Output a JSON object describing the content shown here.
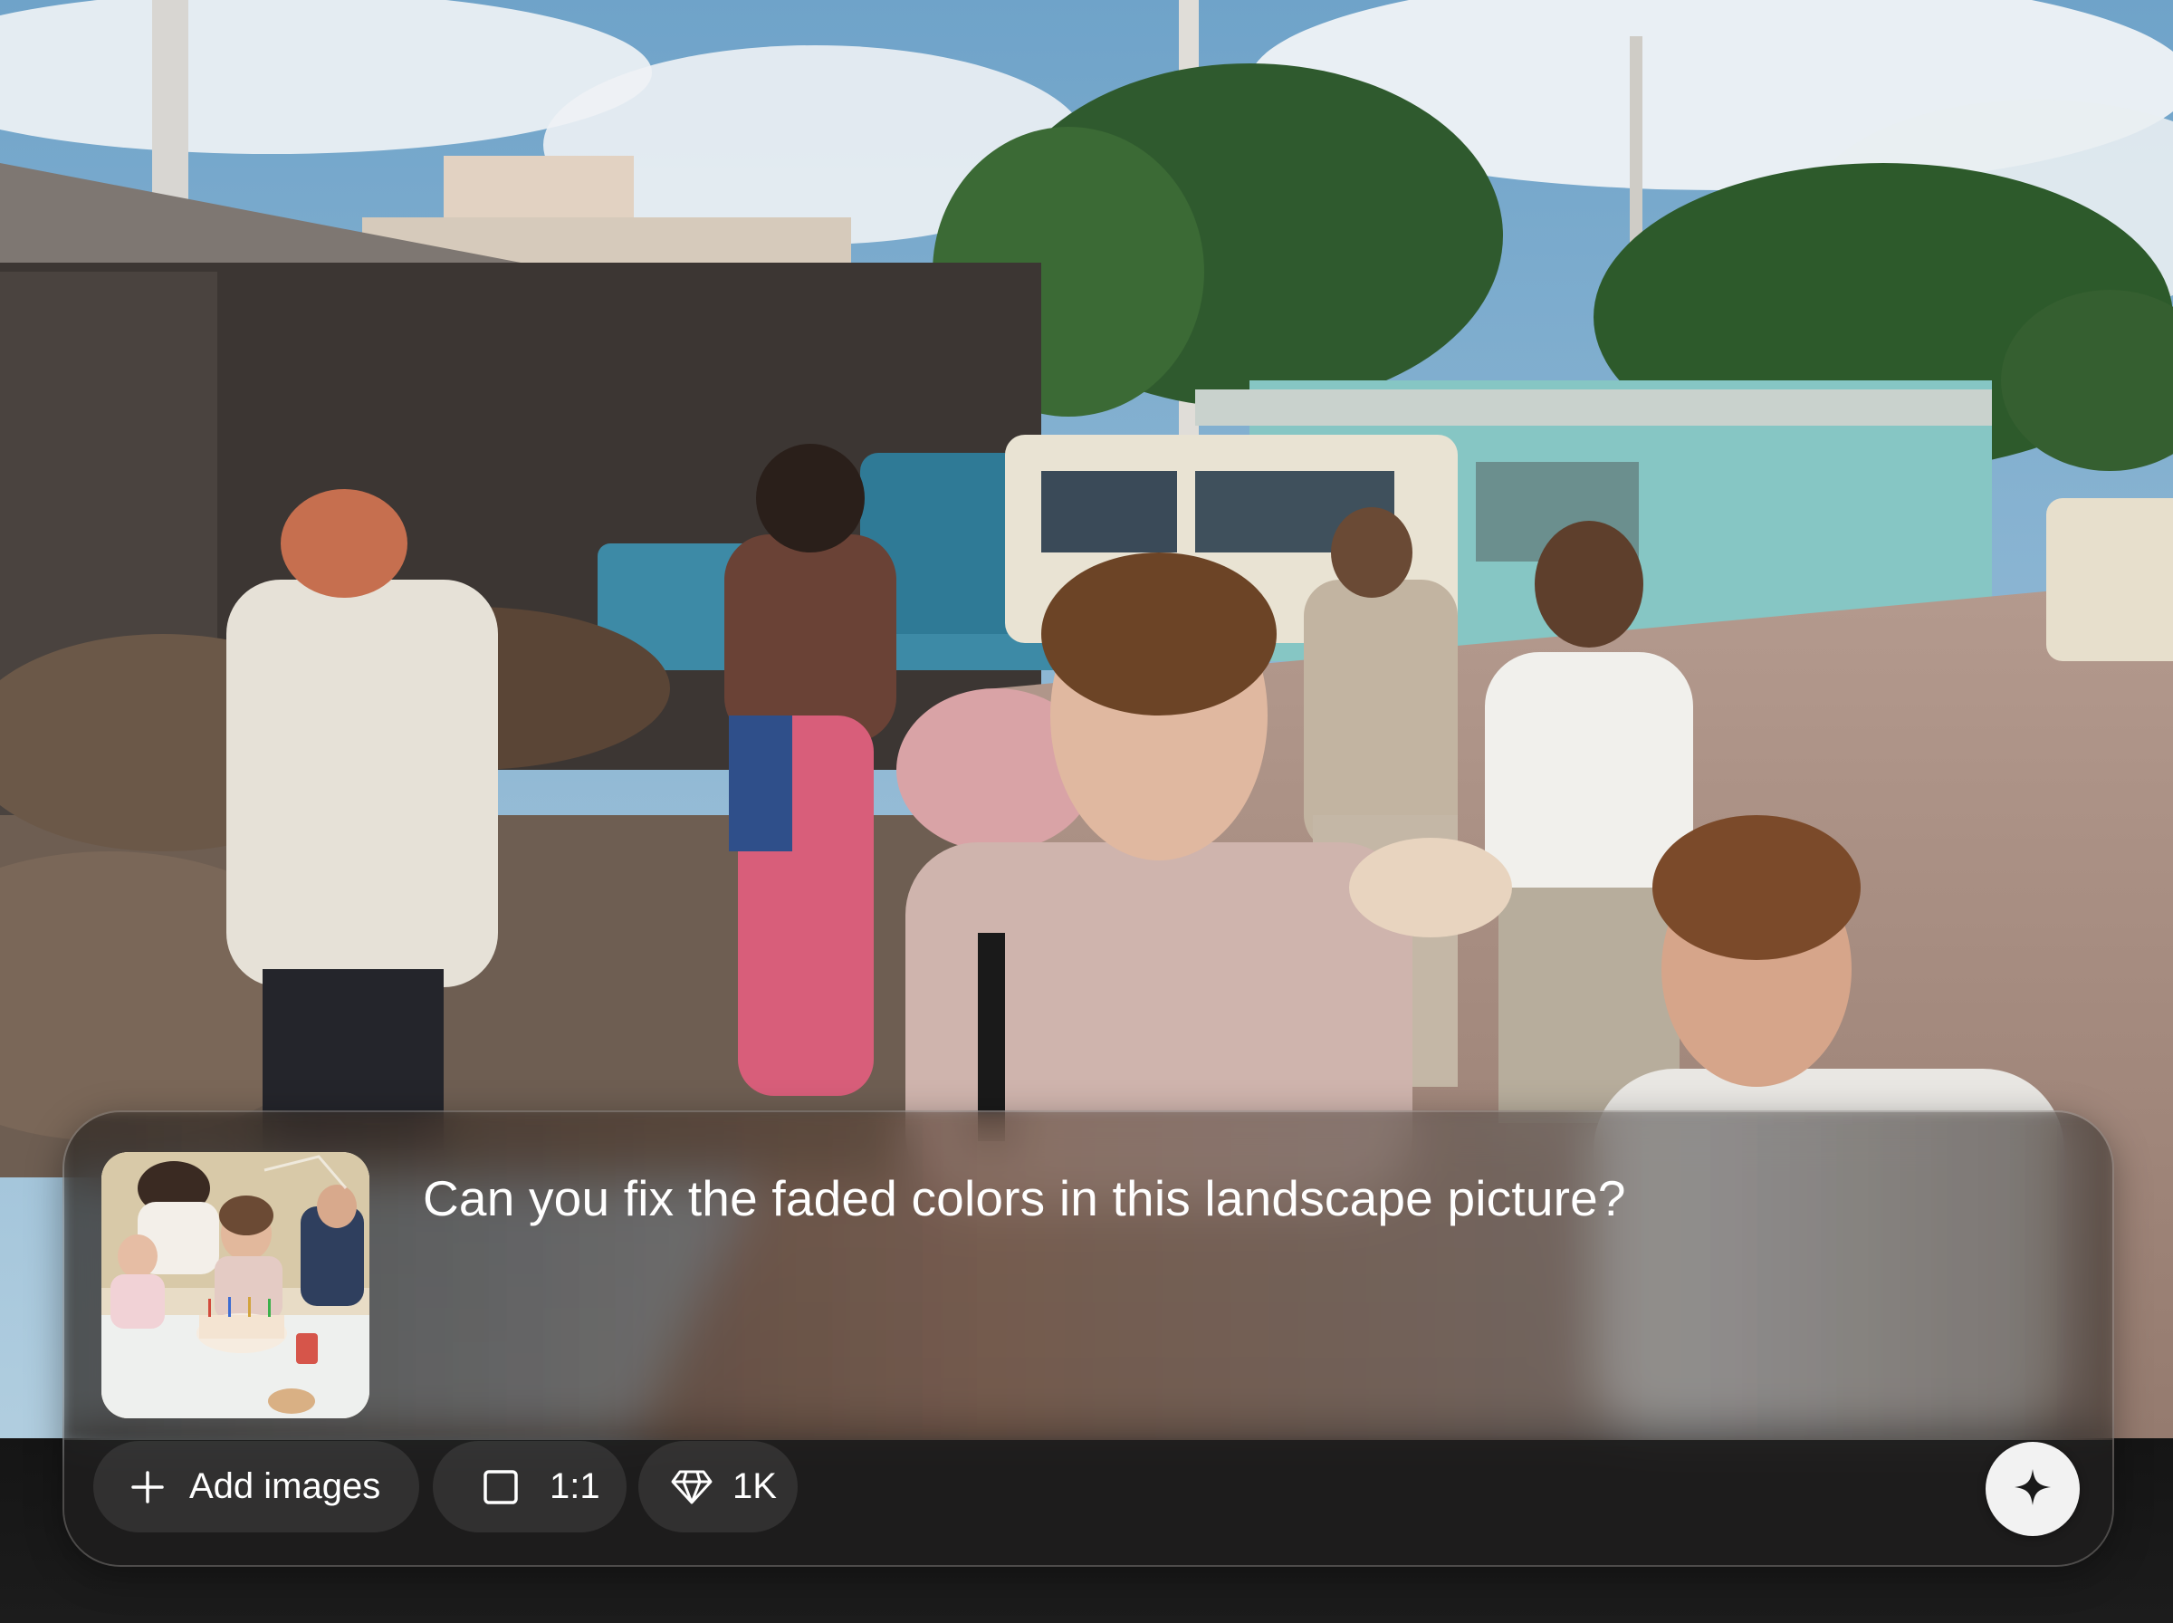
{
  "prompt": {
    "text": "Can you fix the faded colors in this landscape picture?",
    "attachment_icon": "photo-thumbnail"
  },
  "toolbar": {
    "add_images_label": "Add images",
    "add_icon": "plus-icon",
    "aspect_ratio_label": "1:1",
    "aspect_icon": "square-icon",
    "resolution_label": "1K",
    "resolution_icon": "diamond-icon",
    "generate_icon": "sparkle-icon"
  },
  "colors": {
    "text": "#ffffff",
    "pill_bg": "#2a2a2a",
    "generate_bg": "#f2f2f2",
    "bar_bg": "#1a1a1a"
  }
}
